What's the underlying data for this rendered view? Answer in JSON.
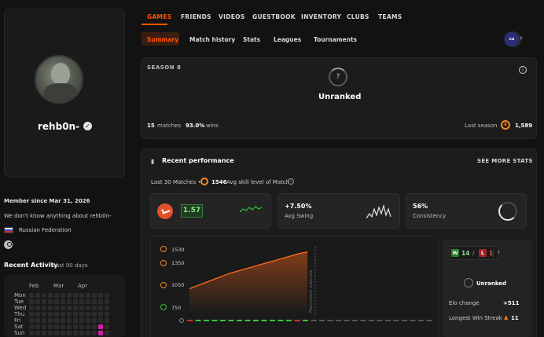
{
  "profile": {
    "nickname": "rehb0n-",
    "member_since": "Member since Mar 31, 2026",
    "bio": "We don't know anything about rehb0n-",
    "country": "Russian Federation"
  },
  "activity": {
    "title": "Recent Activity",
    "subtitle": "Last 90 days",
    "months": [
      "Feb",
      "Mar",
      "Apr"
    ],
    "days": [
      "Mon",
      "Tue",
      "Wed",
      "Thu",
      "Fri",
      "Sat",
      "Sun"
    ]
  },
  "nav": {
    "items": [
      "GAMES",
      "FRIENDS",
      "VIDEOS",
      "GUESTBOOK",
      "INVENTORY",
      "CLUBS",
      "TEAMS"
    ],
    "active": "GAMES"
  },
  "subtabs": {
    "items": [
      "Summary",
      "Match history",
      "Stats",
      "Leagues",
      "Tournaments"
    ],
    "active": "Summary"
  },
  "game_logo": "cs",
  "season": {
    "label": "SEASON 8",
    "rank_icon": "?",
    "rank": "Unranked",
    "matches_num": "15",
    "matches_lbl": "matches",
    "wins_num": "93.0%",
    "wins_lbl": "wins",
    "last_season_lbl": "Last season",
    "last_season_level": "8",
    "last_season_elo": "1,589"
  },
  "performance": {
    "title": "Recent performance",
    "see_more": "SEE MORE STATS",
    "sub_prefix": "Last 30 Matches •",
    "avg_level": "1546",
    "sub_suffix": "Avg skill level of Match",
    "kd": "1.57",
    "swing_val": "+7.50%",
    "swing_lbl": "Avg Swing",
    "consistency_val": "56%",
    "consistency_lbl": "Consistency"
  },
  "chart_data": {
    "type": "area",
    "y_ticks": [
      "1530",
      "1350",
      "1050",
      "750"
    ],
    "y_tick_values": [
      1530,
      1350,
      1050,
      750
    ],
    "ylim": [
      700,
      1600
    ],
    "values": [
      1040,
      1080,
      1120,
      1160,
      1200,
      1240,
      1270,
      1300,
      1330,
      1360,
      1390,
      1420,
      1450,
      1480,
      1510,
      1530
    ],
    "annotation": "Placement matches",
    "results": [
      "L",
      "W",
      "W",
      "W",
      "W",
      "W",
      "W",
      "W",
      "W",
      "W",
      "W",
      "W",
      "W",
      "L",
      "W",
      "N",
      "N",
      "N",
      "N",
      "N",
      "N",
      "N",
      "N",
      "N",
      "N",
      "N",
      "N",
      "N",
      "N",
      "N"
    ],
    "colors": {
      "line": "#ff6a1a",
      "win": "#3cc23c",
      "loss": "#d62b2b",
      "none": "#555555"
    }
  },
  "summary_panel": {
    "wins": "14",
    "separator": "/",
    "losses": "1",
    "next": "›",
    "rank": "Unranked",
    "elo_change_lbl": "Elo change",
    "elo_change_val": "+511",
    "streak_lbl": "Longest Win Streak",
    "streak_val": "11"
  }
}
